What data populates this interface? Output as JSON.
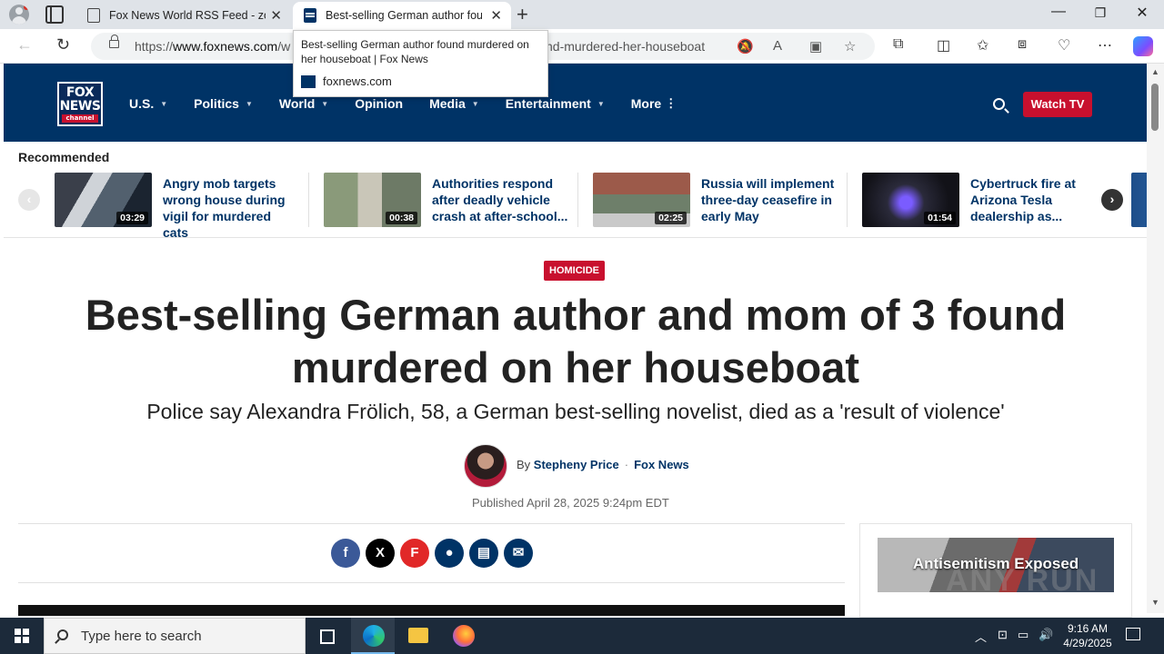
{
  "browser": {
    "tabs": [
      {
        "title": "Fox News World RSS Feed - zovel",
        "active": false
      },
      {
        "title": "Best-selling German author foun",
        "active": true
      }
    ],
    "url_prefix": "https://",
    "url_host": "www.foxnews.com",
    "url_mid": "/w",
    "url_tail": "nd-murdered-her-houseboat",
    "tooltip": {
      "title": "Best-selling German author found murdered on her houseboat | Fox News",
      "domain": "foxnews.com"
    }
  },
  "site": {
    "logo": {
      "line1": "FOX",
      "line2": "NEWS",
      "line3": "channel"
    },
    "nav": [
      {
        "label": "U.S.",
        "caret": "▼"
      },
      {
        "label": "Politics",
        "caret": "▼"
      },
      {
        "label": "World",
        "caret": "▼"
      },
      {
        "label": "Opinion",
        "caret": ""
      },
      {
        "label": "Media",
        "caret": "▼"
      },
      {
        "label": "Entertainment",
        "caret": "▼"
      },
      {
        "label": "More",
        "caret": "⋮"
      }
    ],
    "watch_tv": "Watch TV"
  },
  "recommended": {
    "title": "Recommended",
    "items": [
      {
        "duration": "03:29",
        "headline": "Angry mob targets wrong house during vigil for murdered cats"
      },
      {
        "duration": "00:38",
        "headline": "Authorities respond after deadly vehicle crash at after-school..."
      },
      {
        "duration": "02:25",
        "headline": "Russia will implement three-day ceasefire in early May"
      },
      {
        "duration": "01:54",
        "headline": "Cybertruck fire at Arizona Tesla dealership as..."
      }
    ]
  },
  "article": {
    "eyebrow": "HOMICIDE",
    "headline": "Best-selling German author and mom of 3 found murdered on her houseboat",
    "subhead": "Police say Alexandra Frölich, 58, a German best-selling novelist, died as a 'result of violence'",
    "by": "By",
    "author": "Stepheny Price",
    "outlet": "Fox News",
    "published": "Published April 28, 2025 9:24pm EDT"
  },
  "share": [
    {
      "icon": "facebook-icon",
      "glyph": "f",
      "color": "#3b5998"
    },
    {
      "icon": "x-icon",
      "glyph": "X",
      "color": "#000000"
    },
    {
      "icon": "flipboard-icon",
      "glyph": "F",
      "color": "#e12828"
    },
    {
      "icon": "comment-icon",
      "glyph": "●",
      "color": "#003366"
    },
    {
      "icon": "print-icon",
      "glyph": "▤",
      "color": "#003366"
    },
    {
      "icon": "email-icon",
      "glyph": "✉",
      "color": "#003366"
    }
  ],
  "ad": {
    "text": "Antisemitism Exposed"
  },
  "watermark": "ANY RUN",
  "taskbar": {
    "search_placeholder": "Type here to search",
    "time": "9:16 AM",
    "date": "4/29/2025"
  }
}
